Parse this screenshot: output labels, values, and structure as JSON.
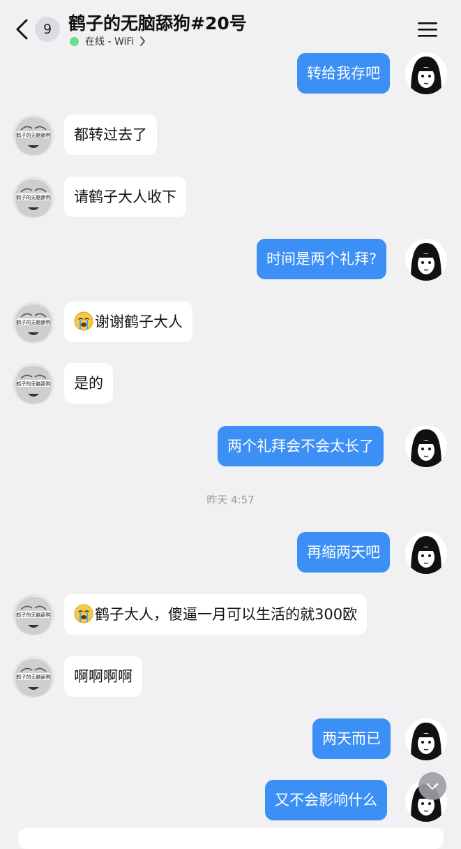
{
  "header": {
    "unread_count": "9",
    "title": "鹤子的无脑舔狗#20号",
    "status": "在线 - WiFi"
  },
  "avatars": {
    "contact_banner_text": "鹤子的无脑舔狗"
  },
  "messages": [
    {
      "side": "out",
      "text": "转给我存吧"
    },
    {
      "side": "in",
      "text": "都转过去了"
    },
    {
      "side": "in",
      "text": "请鹤子大人收下"
    },
    {
      "side": "out",
      "text": "时间是两个礼拜?"
    },
    {
      "side": "in",
      "emoji": "crying-face",
      "text": "谢谢鹤子大人"
    },
    {
      "side": "in",
      "text": "是的"
    },
    {
      "side": "out",
      "text": "两个礼拜会不会太长了"
    },
    {
      "side": "out",
      "text": "再缩两天吧"
    },
    {
      "side": "in",
      "emoji": "crying-face",
      "text": "鹤子大人，傻逼一月可以生活的就300欧"
    },
    {
      "side": "in",
      "text": "啊啊啊啊"
    },
    {
      "side": "out",
      "text": "两天而已"
    },
    {
      "side": "out",
      "text": "又不会影响什么"
    }
  ],
  "timestamp": "昨天 4:57",
  "colors": {
    "outgoing_bubble": "#3c8ff5",
    "incoming_bubble": "#ffffff",
    "background": "#f1f1f3",
    "online_dot": "#6fdc8c"
  }
}
